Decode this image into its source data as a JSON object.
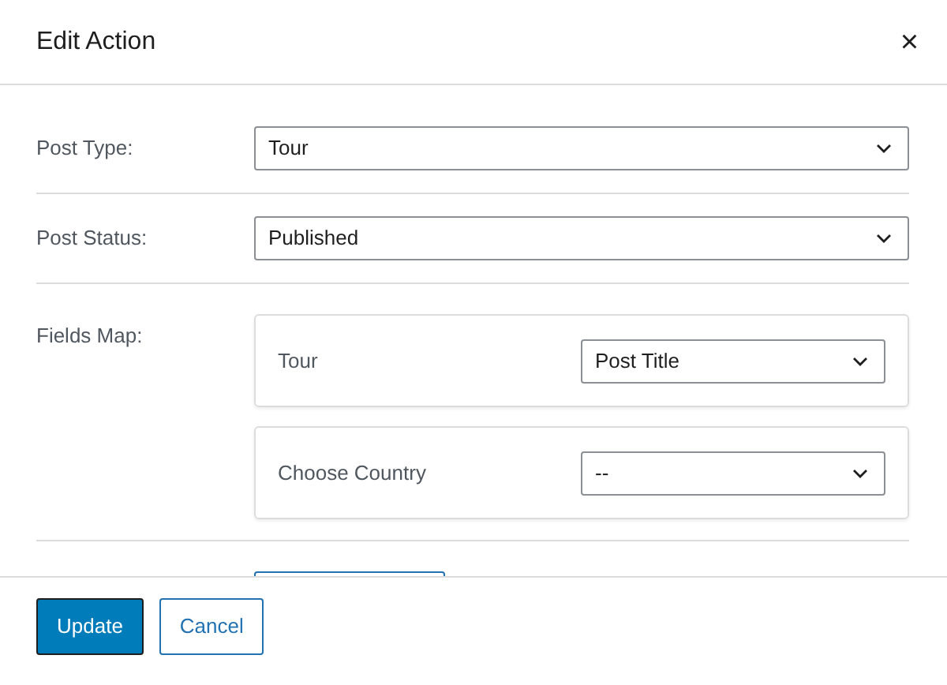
{
  "window": {
    "title": "Edit Action",
    "close": "×"
  },
  "fields": [
    {
      "label": "Post Type:",
      "value": "Tour"
    },
    {
      "label": "Post Status:",
      "value": "Published"
    }
  ],
  "fields_map": {
    "label": "Fields Map:",
    "rows": [
      {
        "label": "Tour",
        "value": "Post Title"
      },
      {
        "label": "Choose Country",
        "value": "--"
      }
    ]
  },
  "buttons": [
    {
      "label": "Update",
      "kind": "primary"
    },
    {
      "label": "Cancel",
      "kind": "secondary"
    }
  ]
}
